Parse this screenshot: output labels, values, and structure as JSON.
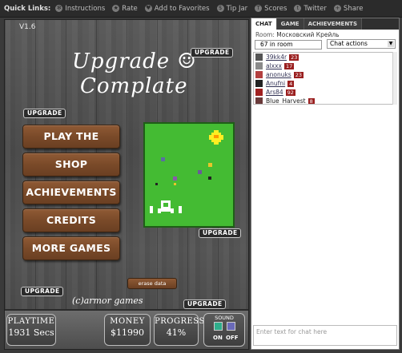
{
  "topbar": {
    "quick_links_label": "Quick Links:",
    "links": [
      {
        "label": "Instructions",
        "icon": "gear-icon"
      },
      {
        "label": "Rate",
        "icon": "star-icon"
      },
      {
        "label": "Add to Favorites",
        "icon": "heart-icon"
      },
      {
        "label": "Tip Jar",
        "icon": "coin-icon"
      },
      {
        "label": "Scores",
        "icon": "trophy-icon"
      },
      {
        "label": "Twitter",
        "icon": "twitter-icon"
      },
      {
        "label": "Share",
        "icon": "share-icon"
      }
    ]
  },
  "game": {
    "version": "V1.6",
    "title_line1": "Upgrade ☺",
    "title_line2": "Complate",
    "upgrade_badge": "UPGRADE",
    "menu": [
      {
        "label": "PLAY THE GAME!"
      },
      {
        "label": "SHOP"
      },
      {
        "label": "ACHIEVEMENTS"
      },
      {
        "label": "CREDITS"
      },
      {
        "label": "MORE GAMES"
      }
    ],
    "erase_label": "erase data",
    "credit_text": "(c)armor games",
    "stats": {
      "playtime_label": "PLAYTIME",
      "playtime_value": "1931 Secs",
      "money_label": "MONEY",
      "money_value": "$11990",
      "progress_label": "PROGRESS",
      "progress_value": "41%",
      "sound_label": "SOUND",
      "sound_on": "ON",
      "sound_off": "OFF"
    },
    "colors": {
      "preview_bg": "#44bb33",
      "wood": "#7a4a29",
      "sound_on": "#2fae8c",
      "sound_off": "#6a6ab8"
    }
  },
  "chat": {
    "tabs": [
      {
        "label": "CHAT",
        "active": true
      },
      {
        "label": "GAME",
        "active": false
      },
      {
        "label": "ACHIEVEMENTS",
        "active": false
      }
    ],
    "room_label": "Room:",
    "room_name": "Московский Крейль",
    "in_room": "67 in room",
    "actions_label": "Chat actions",
    "users": [
      {
        "name": "39kk4r",
        "level": "23"
      },
      {
        "name": "alxxx",
        "level": "17"
      },
      {
        "name": "anonuks",
        "level": "23"
      },
      {
        "name": "Anufni",
        "level": "4"
      },
      {
        "name": "Ars84",
        "level": "92"
      },
      {
        "name": "Blue_Harvest",
        "level": "8"
      }
    ],
    "input_placeholder": "Enter text for chat here"
  }
}
